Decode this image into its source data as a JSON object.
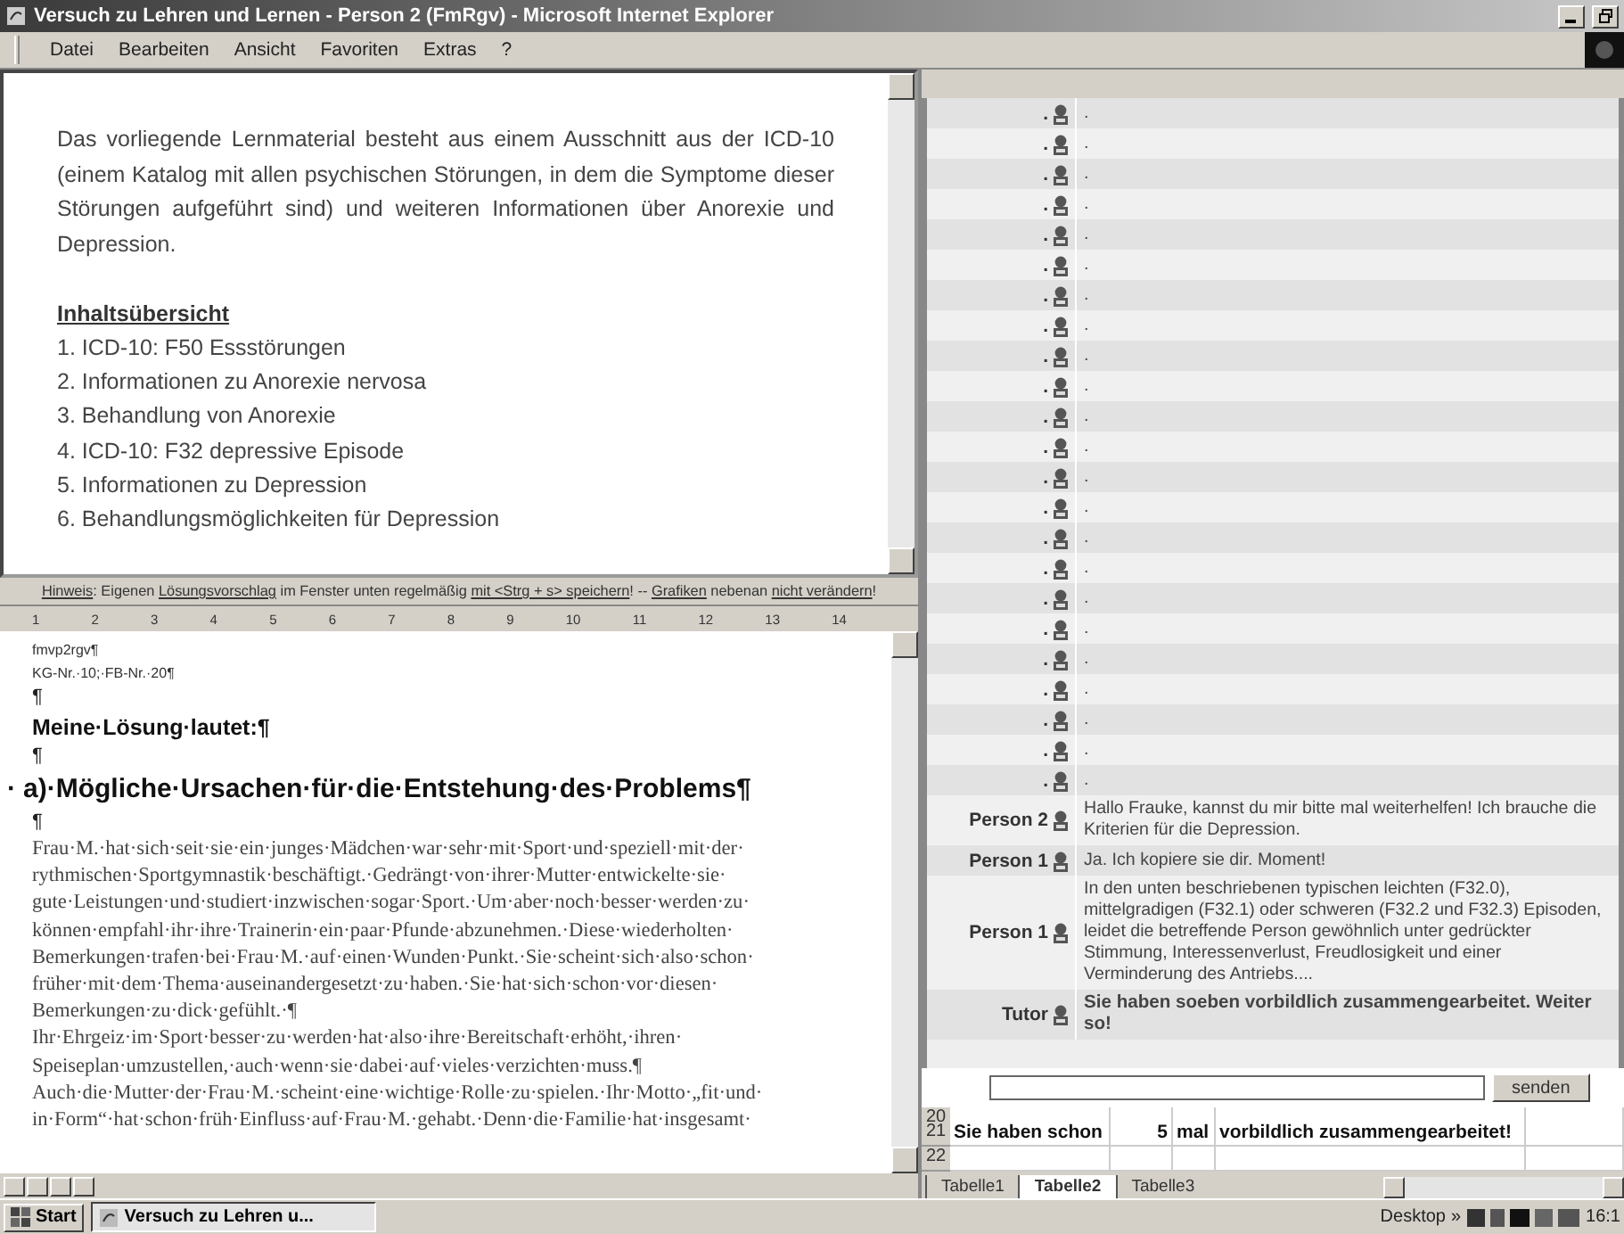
{
  "window": {
    "title": "Versuch zu Lehren und Lernen - Person 2 (FmRgv) - Microsoft Internet Explorer"
  },
  "menu": [
    "Datei",
    "Bearbeiten",
    "Ansicht",
    "Favoriten",
    "Extras",
    "?"
  ],
  "content": {
    "intro": "Das vorliegende Lernmaterial besteht aus einem Ausschnitt aus der ICD-10 (einem Katalog mit allen psychischen Störungen, in dem die Symptome dieser Störungen aufgeführt sind) und weiteren Informationen über Anorexie und Depression.",
    "toc_title": "Inhaltsübersicht",
    "toc": [
      "1. ICD-10: F50 Essstörungen",
      "2. Informationen zu Anorexie nervosa",
      "3. Behandlung von Anorexie",
      "4. ICD-10: F32 depressive Episode",
      "5. Informationen zu Depression",
      "6. Behandlungsmöglichkeiten für Depression"
    ]
  },
  "hint": [
    {
      "text": "Hinweis",
      "underlined": true
    },
    {
      "text": ": Eigenen ",
      "underlined": false
    },
    {
      "text": "Lösungsvorschlag",
      "underlined": true
    },
    {
      "text": " im Fenster unten regelmäßig ",
      "underlined": false
    },
    {
      "text": "mit <Strg + s> speichern",
      "underlined": true
    },
    {
      "text": "! -- ",
      "underlined": false
    },
    {
      "text": "Grafiken",
      "underlined": true
    },
    {
      "text": " nebenan ",
      "underlined": false
    },
    {
      "text": "nicht verändern",
      "underlined": true
    },
    {
      "text": "!",
      "underlined": false
    }
  ],
  "ruler": [
    "1",
    "2",
    "3",
    "4",
    "5",
    "6",
    "7",
    "8",
    "9",
    "10",
    "11",
    "12",
    "13",
    "14"
  ],
  "document": {
    "lines": [
      {
        "kind": "meta",
        "text": "fmvp2rgv¶"
      },
      {
        "kind": "meta",
        "text": "KG-Nr.·10;·FB-Nr.·20¶"
      },
      {
        "kind": "pilcrow",
        "text": "¶"
      },
      {
        "kind": "subheading",
        "text": "Meine·Lösung·lautet:¶"
      },
      {
        "kind": "pilcrow",
        "text": "¶"
      },
      {
        "kind": "heading",
        "marker": "·",
        "text": "a)·Mögliche·Ursachen·für·die·Entstehung·des·Problems¶"
      },
      {
        "kind": "pilcrow",
        "text": "¶"
      },
      {
        "kind": "body",
        "text": "Frau·M.·hat·sich·seit·sie·ein·junges·Mädchen·war·sehr·mit·Sport·und·speziell·mit·der·"
      },
      {
        "kind": "body",
        "text": "rythmischen·Sportgymnastik·beschäftigt.·Gedrängt·von·ihrer·Mutter·entwickelte·sie·"
      },
      {
        "kind": "body",
        "text": "gute·Leistungen·und·studiert·inzwischen·sogar·Sport.·Um·aber·noch·besser·werden·zu·"
      },
      {
        "kind": "body",
        "text": "können·empfahl·ihr·ihre·Trainerin·ein·paar·Pfunde·abzunehmen.·Diese·wiederholten·"
      },
      {
        "kind": "body",
        "text": "Bemerkungen·trafen·bei·Frau·M.·auf·einen·Wunden·Punkt.·Sie·scheint·sich·also·schon·"
      },
      {
        "kind": "body",
        "text": "früher·mit·dem·Thema·auseinandergesetzt·zu·haben.·Sie·hat·sich·schon·vor·diesen·"
      },
      {
        "kind": "body",
        "text": "Bemerkungen·zu·dick·gefühlt.·¶"
      },
      {
        "kind": "body",
        "text": "Ihr·Ehrgeiz·im·Sport·besser·zu·werden·hat·also·ihre·Bereitschaft·erhöht,·ihren·"
      },
      {
        "kind": "body",
        "text": "Speiseplan·umzustellen,·auch·wenn·sie·dabei·auf·vieles·verzichten·muss.¶"
      },
      {
        "kind": "body",
        "text": "Auch·die·Mutter·der·Frau·M.·scheint·eine·wichtige·Rolle·zu·spielen.·Ihr·Motto·„fit·und·"
      },
      {
        "kind": "body",
        "text": "in·Form“·hat·schon·früh·Einfluss·auf·Frau·M.·gehabt.·Denn·die·Familie·hat·insgesamt·"
      }
    ]
  },
  "chat": {
    "messages": [
      {
        "kind": "user",
        "author": ".",
        "text": "."
      },
      {
        "kind": "user",
        "author": ".",
        "text": "."
      },
      {
        "kind": "user",
        "author": ".",
        "text": "."
      },
      {
        "kind": "user",
        "author": ".",
        "text": "."
      },
      {
        "kind": "user",
        "author": ".",
        "text": "."
      },
      {
        "kind": "user",
        "author": ".",
        "text": "."
      },
      {
        "kind": "user",
        "author": ".",
        "text": "."
      },
      {
        "kind": "user",
        "author": ".",
        "text": "."
      },
      {
        "kind": "user",
        "author": ".",
        "text": "."
      },
      {
        "kind": "user",
        "author": ".",
        "text": "."
      },
      {
        "kind": "user",
        "author": ".",
        "text": "."
      },
      {
        "kind": "user",
        "author": ".",
        "text": "."
      },
      {
        "kind": "user",
        "author": ".",
        "text": "."
      },
      {
        "kind": "user",
        "author": ".",
        "text": "."
      },
      {
        "kind": "user",
        "author": ".",
        "text": "."
      },
      {
        "kind": "user",
        "author": ".",
        "text": "."
      },
      {
        "kind": "user",
        "author": ".",
        "text": "."
      },
      {
        "kind": "user",
        "author": ".",
        "text": "."
      },
      {
        "kind": "user",
        "author": ".",
        "text": "."
      },
      {
        "kind": "user",
        "author": ".",
        "text": "."
      },
      {
        "kind": "user",
        "author": ".",
        "text": "."
      },
      {
        "kind": "user",
        "author": ".",
        "text": "."
      },
      {
        "kind": "user",
        "author": ".",
        "text": "."
      },
      {
        "kind": "user",
        "author": "Person 2",
        "text": "Hallo Frauke, kannst du mir bitte mal weiterhelfen! Ich brauche die Kriterien für die Depression."
      },
      {
        "kind": "user",
        "author": "Person 1",
        "text": "Ja. Ich kopiere sie dir. Moment!"
      },
      {
        "kind": "user",
        "author": "Person 1",
        "text": "In den unten beschriebenen typischen leichten (F32.0), mittelgradigen (F32.1) oder schweren (F32.2 und F32.3) Episoden, leidet die betreffende Person gewöhnlich unter gedrückter Stimmung, Interessenverlust, Freudlosigkeit und einer Verminderung des Antriebs...."
      },
      {
        "kind": "tutor",
        "author": "Tutor",
        "text": "Sie haben soeben vorbildlich zusammengearbeitet. Weiter so!"
      }
    ],
    "button": "senden"
  },
  "sheet": {
    "rows": [
      {
        "number": "20"
      },
      {
        "number": "21",
        "cells": [
          "Sie haben schon",
          "5",
          "mal",
          "vorbildlich zusammengearbeitet!"
        ]
      },
      {
        "number": "22"
      }
    ],
    "tabs": [
      {
        "label": "Tabelle1",
        "selected": false
      },
      {
        "label": "Tabelle2",
        "selected": true
      },
      {
        "label": "Tabelle3",
        "selected": false
      }
    ]
  },
  "taskbar": {
    "start": "Start",
    "task": "Versuch zu Lehren u...",
    "desktop": "Desktop",
    "chevron": "»",
    "clock": "16:1"
  }
}
